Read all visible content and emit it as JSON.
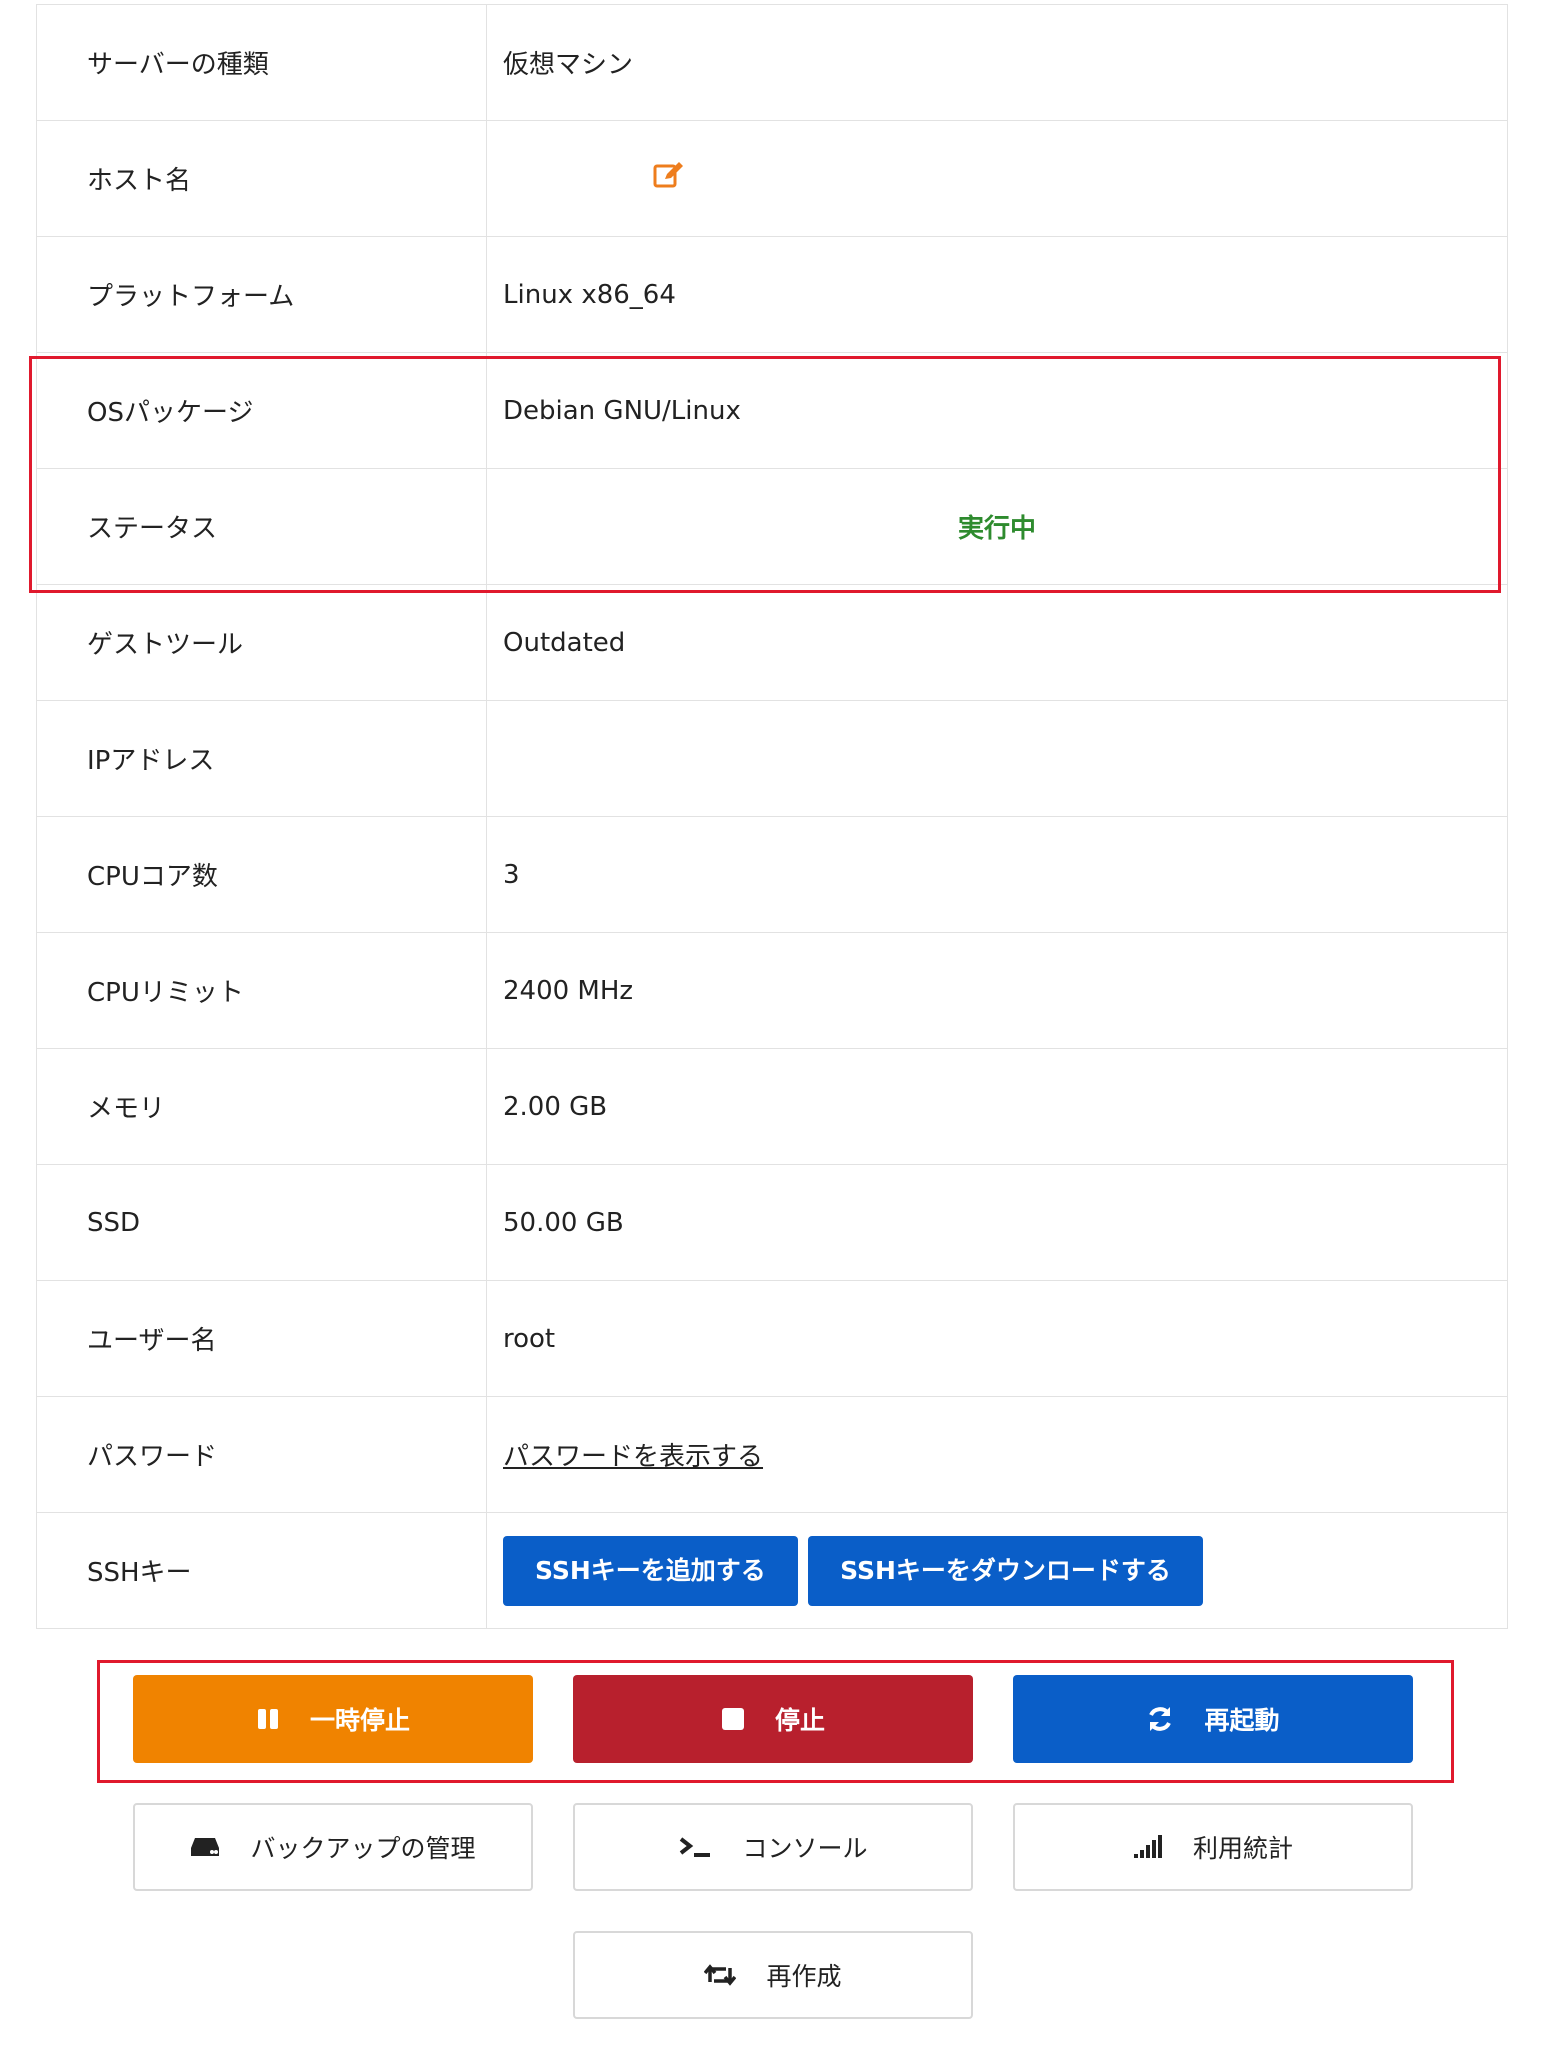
{
  "table": {
    "rows": [
      {
        "label": "サーバーの種類",
        "value": "仮想マシン"
      },
      {
        "label": "ホスト名",
        "value": ""
      },
      {
        "label": "プラットフォーム",
        "value": "Linux x86_64"
      },
      {
        "label": "OSパッケージ",
        "value": "Debian GNU/Linux"
      },
      {
        "label": "ステータス",
        "value": "実行中"
      },
      {
        "label": "ゲストツール",
        "value": "Outdated"
      },
      {
        "label": "IPアドレス",
        "value": ""
      },
      {
        "label": "CPUコア数",
        "value": "3"
      },
      {
        "label": "CPUリミット",
        "value": "2400 MHz"
      },
      {
        "label": "メモリ",
        "value": "2.00 GB"
      },
      {
        "label": "SSD",
        "value": "50.00 GB"
      },
      {
        "label": "ユーザー名",
        "value": "root"
      },
      {
        "label": "パスワード",
        "value": "パスワードを表示する"
      },
      {
        "label": "SSHキー",
        "value": ""
      }
    ],
    "ssh_add_label": "SSHキーを追加する",
    "ssh_download_label": "SSHキーをダウンロードする"
  },
  "actions": {
    "pause_label": "一時停止",
    "stop_label": "停止",
    "restart_label": "再起動",
    "backup_label": "バックアップの管理",
    "console_label": "コンソール",
    "stats_label": "利用統計",
    "recreate_label": "再作成"
  },
  "colors": {
    "pause": "#f08300",
    "stop": "#b8202d",
    "restart": "#0a5ec8",
    "status_running": "#2e8b2e",
    "edit_icon": "#ee7d1d",
    "highlight": "#e0192d"
  },
  "icons": {
    "edit": "edit-icon",
    "pause": "pause-icon",
    "stop": "stop-icon",
    "restart": "refresh-icon",
    "backup": "hard-drive-icon",
    "console": "terminal-icon",
    "stats": "signal-bars-icon",
    "recreate": "retweet-icon"
  }
}
